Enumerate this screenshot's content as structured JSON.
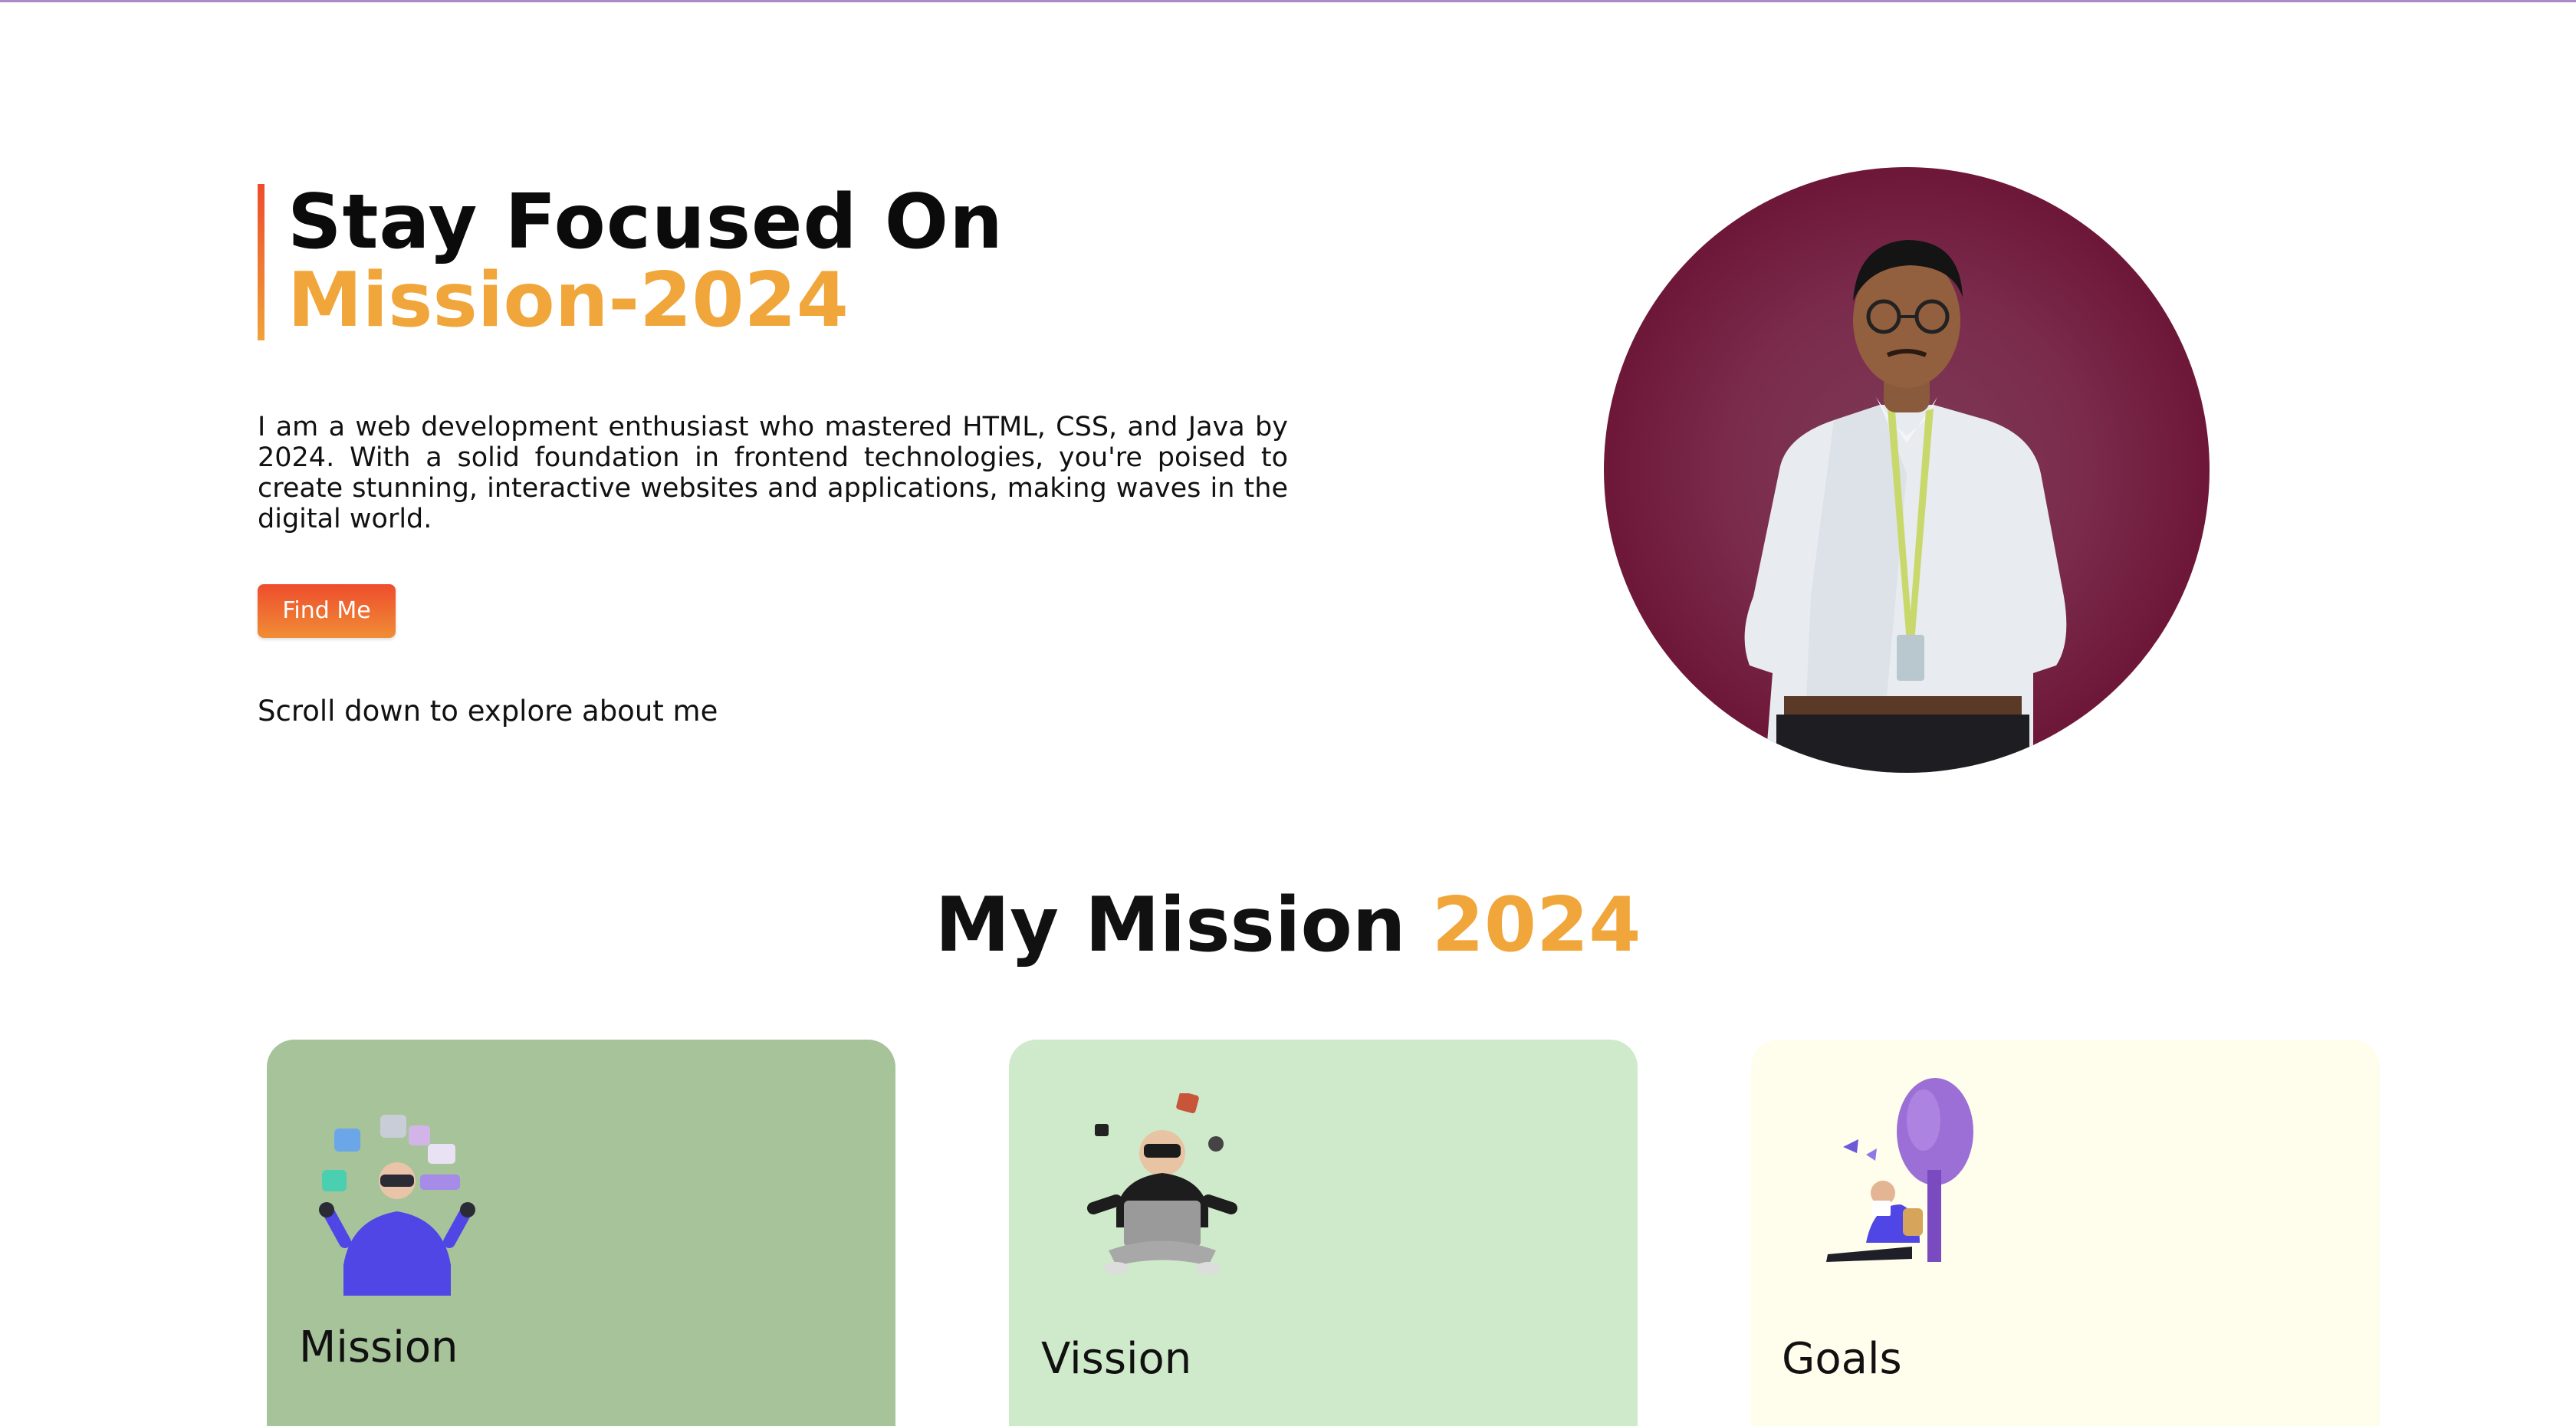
{
  "hero": {
    "title_line1": "Stay Focused On",
    "title_line2": "Mission-2024",
    "description": "I am a web development enthusiast who mastered HTML, CSS, and Java by 2024. With a solid foundation in frontend technologies, you're poised to create stunning, interactive websites and applications, making waves in the digital world.",
    "cta_label": "Find Me",
    "scroll_hint": "Scroll down to explore about me"
  },
  "portrait": {
    "icon": "person-portrait",
    "background_color": "#7b2c4d"
  },
  "section": {
    "title_main": "My Mission",
    "title_accent": "2024"
  },
  "cards": [
    {
      "label": "Mission",
      "icon": "vr-person-illustration",
      "color": "#a6c39a"
    },
    {
      "label": "Vission",
      "icon": "laptop-person-illustration",
      "color": "#cfeaca"
    },
    {
      "label": "Goals",
      "icon": "reading-tree-illustration",
      "color": "#fffdec"
    }
  ],
  "colors": {
    "accent": "#f0a63a",
    "button_gradient_start": "#ee4d2d",
    "button_gradient_end": "#f08d35",
    "top_line": "#a98bc7"
  }
}
